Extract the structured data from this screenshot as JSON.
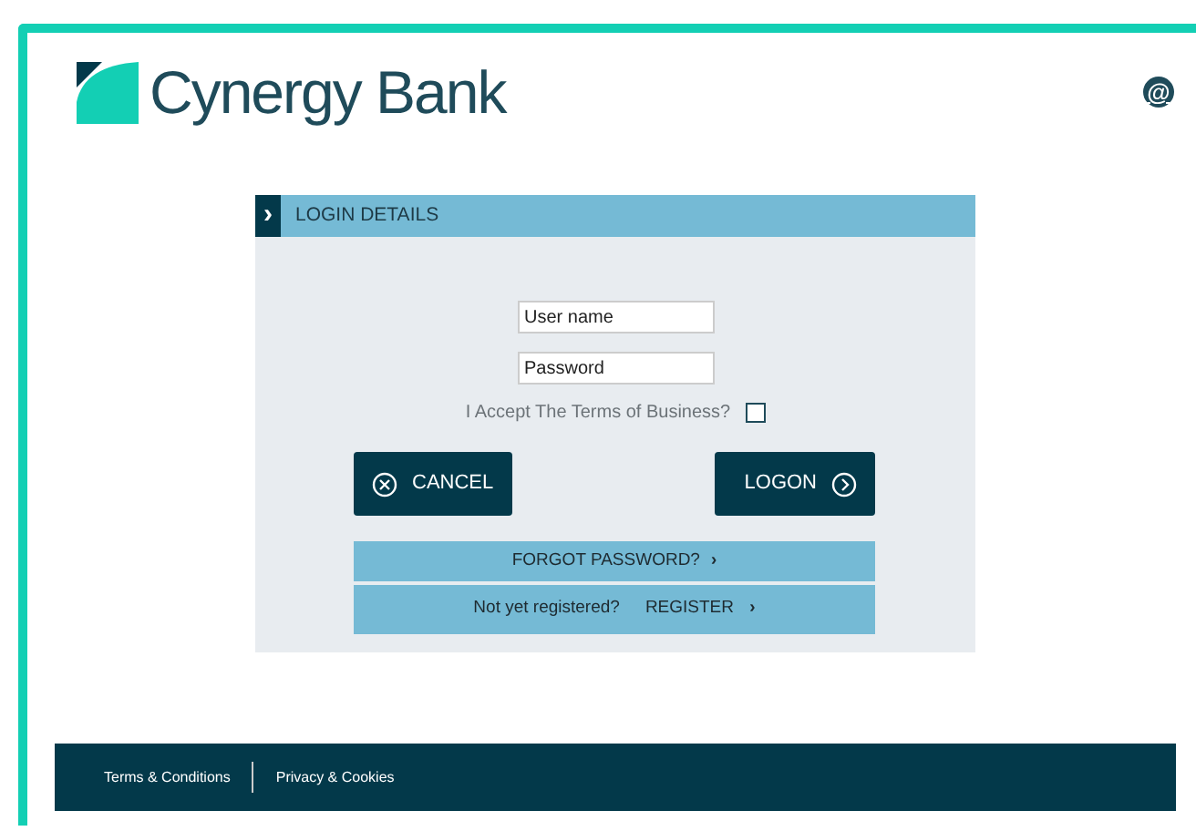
{
  "header": {
    "brand": "Cynergy Bank",
    "contact_icon": "@"
  },
  "login": {
    "title": "LOGIN DETAILS",
    "title_marker": "›",
    "fields": [
      {
        "placeholder": "User name"
      },
      {
        "placeholder": "Password"
      }
    ],
    "terms": {
      "label": "I Accept The Terms of Business?",
      "checked": false
    },
    "cancel": "CANCEL",
    "logon": "LOGON",
    "forgot": {
      "label": "FORGOT PASSWORD?",
      "chevron": "›"
    },
    "register": {
      "prompt": "Not yet registered?",
      "label": "REGISTER",
      "chevron": "›"
    }
  },
  "footer": {
    "links": [
      "Terms & Conditions",
      "Privacy & Cookies"
    ]
  }
}
